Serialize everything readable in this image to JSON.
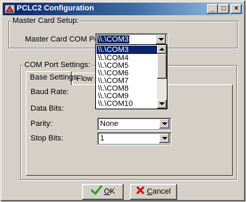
{
  "window": {
    "title": "PCLC2 Configuration",
    "controls": {
      "minimize": "_",
      "maximize": "□",
      "close": "×"
    }
  },
  "master_card": {
    "group_label": "Master Card Setup:",
    "com_port_label": "Master Card COM Port:",
    "com_port_value": "\\\\.\\COM3"
  },
  "com_dropdown": {
    "options": [
      "\\\\.\\COM3",
      "\\\\.\\COM4",
      "\\\\.\\COM5",
      "\\\\.\\COM6",
      "\\\\.\\COM7",
      "\\\\.\\COM8",
      "\\\\.\\COM9",
      "\\\\.\\COM10"
    ],
    "highlighted": "\\\\.\\COM3"
  },
  "com_settings": {
    "group_label": "COM Port Settings:",
    "tabs": [
      {
        "label": "Base Settings"
      },
      {
        "label": "Flow Control"
      }
    ],
    "baud_rate_label": "Baud Rate:",
    "data_bits_label": "Data Bits:",
    "parity_label": "Parity:",
    "parity_value": "None",
    "stop_bits_label": "Stop Bits:",
    "stop_bits_value": "1"
  },
  "buttons": {
    "ok_label": "OK",
    "ok_accel": "O",
    "ok_rest": "K",
    "cancel_label": "Cancel",
    "cancel_accel": "C",
    "cancel_rest": "ancel"
  },
  "colors": {
    "titlebar_start": "#0a246a",
    "titlebar_end": "#a6caf0",
    "selection": "#0a246a",
    "ok_check": "#2e9e2e",
    "cancel_x": "#d01010"
  },
  "icons": {
    "app": "pclc-app-icon",
    "ok": "check-icon",
    "cancel": "x-icon"
  }
}
